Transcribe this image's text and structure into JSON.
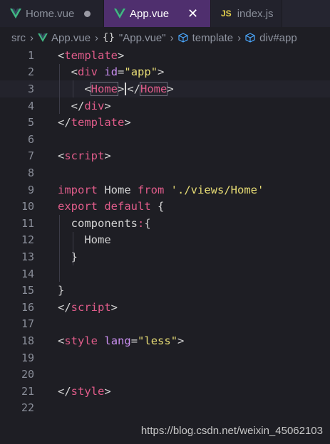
{
  "tabs": [
    {
      "label": "Home.vue",
      "icon": "vue-icon",
      "modified": true
    },
    {
      "label": "App.vue",
      "icon": "vue-icon",
      "active": true,
      "close": "✕"
    },
    {
      "label": "index.js",
      "icon_text": "JS"
    }
  ],
  "breadcrumb": {
    "src": "src",
    "file": "App.vue",
    "braces": "{}",
    "component": "\"App.vue\"",
    "template": "template",
    "div": "div#app"
  },
  "lines": [
    {
      "n": "1",
      "tokens": [
        [
          "punc",
          "<"
        ],
        [
          "tag",
          "template"
        ],
        [
          "punc",
          ">"
        ]
      ]
    },
    {
      "n": "2",
      "tokens": [
        [
          "plain",
          "  "
        ],
        [
          "punc",
          "<"
        ],
        [
          "tag",
          "div"
        ],
        [
          "plain",
          " "
        ],
        [
          "attr",
          "id"
        ],
        [
          "punc",
          "="
        ],
        [
          "str",
          "\"app\""
        ],
        [
          "punc",
          ">"
        ]
      ]
    },
    {
      "n": "3",
      "tokens": [
        [
          "plain",
          "    "
        ],
        [
          "punc",
          "<"
        ],
        [
          "tag",
          "Home"
        ],
        [
          "punc",
          ">"
        ],
        [
          "cursor",
          ""
        ],
        [
          "punc",
          "</"
        ],
        [
          "tag",
          "Home"
        ],
        [
          "punc",
          ">"
        ]
      ]
    },
    {
      "n": "4",
      "tokens": [
        [
          "plain",
          "  "
        ],
        [
          "punc",
          "</"
        ],
        [
          "tag",
          "div"
        ],
        [
          "punc",
          ">"
        ]
      ]
    },
    {
      "n": "5",
      "tokens": [
        [
          "punc",
          "</"
        ],
        [
          "tag",
          "template"
        ],
        [
          "punc",
          ">"
        ]
      ]
    },
    {
      "n": "6",
      "tokens": []
    },
    {
      "n": "7",
      "tokens": [
        [
          "punc",
          "<"
        ],
        [
          "tag",
          "script"
        ],
        [
          "punc",
          ">"
        ]
      ]
    },
    {
      "n": "8",
      "tokens": []
    },
    {
      "n": "9",
      "tokens": [
        [
          "kw",
          "import"
        ],
        [
          "plain",
          " Home "
        ],
        [
          "kw",
          "from"
        ],
        [
          "plain",
          " "
        ],
        [
          "str",
          "'./views/Home'"
        ]
      ]
    },
    {
      "n": "10",
      "tokens": [
        [
          "kw",
          "export"
        ],
        [
          "plain",
          " "
        ],
        [
          "kw",
          "default"
        ],
        [
          "plain",
          " {"
        ]
      ]
    },
    {
      "n": "11",
      "tokens": [
        [
          "plain",
          "  components"
        ],
        [
          "kw",
          ":"
        ],
        [
          "plain",
          "{"
        ]
      ]
    },
    {
      "n": "12",
      "tokens": [
        [
          "plain",
          "    Home"
        ]
      ]
    },
    {
      "n": "13",
      "tokens": [
        [
          "plain",
          "  }"
        ]
      ]
    },
    {
      "n": "14",
      "tokens": []
    },
    {
      "n": "15",
      "tokens": [
        [
          "plain",
          "}"
        ]
      ]
    },
    {
      "n": "16",
      "tokens": [
        [
          "punc",
          "</"
        ],
        [
          "tag",
          "script"
        ],
        [
          "punc",
          ">"
        ]
      ]
    },
    {
      "n": "17",
      "tokens": []
    },
    {
      "n": "18",
      "tokens": [
        [
          "punc",
          "<"
        ],
        [
          "tag",
          "style"
        ],
        [
          "plain",
          " "
        ],
        [
          "attr",
          "lang"
        ],
        [
          "punc",
          "="
        ],
        [
          "str",
          "\"less\""
        ],
        [
          "punc",
          ">"
        ]
      ]
    },
    {
      "n": "19",
      "tokens": []
    },
    {
      "n": "20",
      "tokens": []
    },
    {
      "n": "21",
      "tokens": [
        [
          "punc",
          "</"
        ],
        [
          "tag",
          "style"
        ],
        [
          "punc",
          ">"
        ]
      ]
    },
    {
      "n": "22",
      "tokens": []
    }
  ],
  "watermark": "https://blog.csdn.net/weixin_45062103",
  "colors": {
    "tag": "#e05c8a",
    "attr": "#c98ef0",
    "string": "#e6db74",
    "keyword": "#e05c8a",
    "active_tab": "#4f2f6e",
    "vue_green": "#41b883"
  }
}
